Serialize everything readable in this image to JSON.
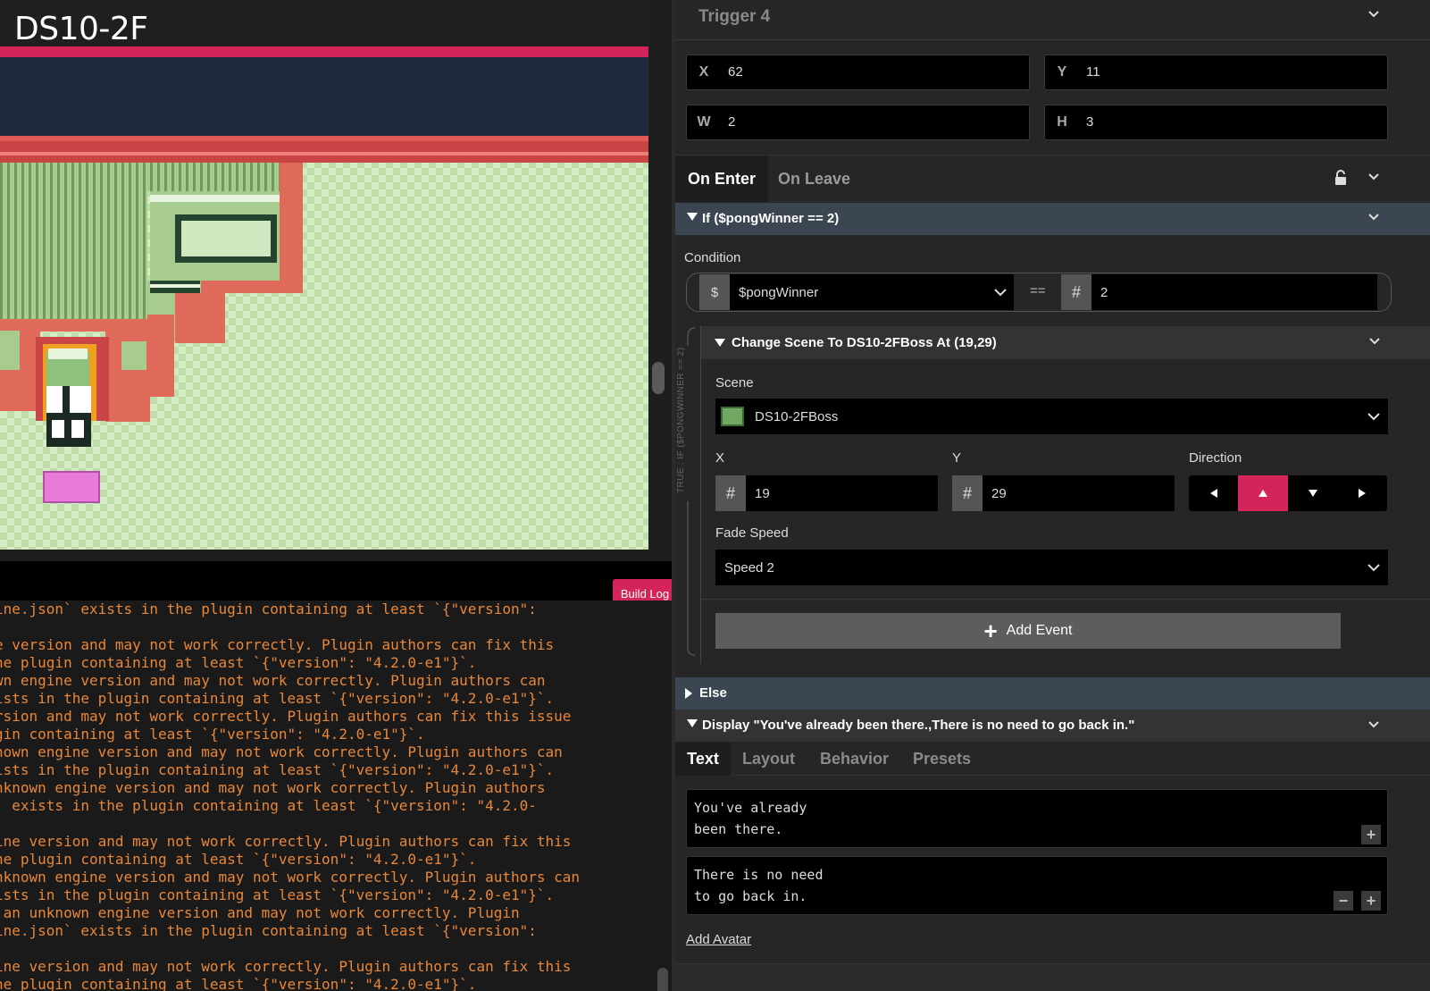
{
  "scene": {
    "title": "DS10-2F",
    "build_log_label": "Build Log"
  },
  "console": {
    "lines": [
      "ine.json` exists in the plugin containing at least `{\"version\":",
      "",
      "e version and may not work correctly. Plugin authors can fix this",
      "he plugin containing at least `{\"version\": \"4.2.0-e1\"}`.",
      "wn engine version and may not work correctly. Plugin authors can",
      "ists in the plugin containing at least `{\"version\": \"4.2.0-e1\"}`.",
      "rsion and may not work correctly. Plugin authors can fix this issue",
      "gin containing at least `{\"version\": \"4.2.0-e1\"}`.",
      "nown engine version and may not work correctly. Plugin authors can",
      "ists in the plugin containing at least `{\"version\": \"4.2.0-e1\"}`.",
      "nknown engine version and may not work correctly. Plugin authors",
      "` exists in the plugin containing at least `{\"version\": \"4.2.0-",
      "",
      "ine version and may not work correctly. Plugin authors can fix this",
      "he plugin containing at least `{\"version\": \"4.2.0-e1\"}`.",
      "nknown engine version and may not work correctly. Plugin authors can",
      "ists in the plugin containing at least `{\"version\": \"4.2.0-e1\"}`.",
      " an unknown engine version and may not work correctly. Plugin",
      "ine.json` exists in the plugin containing at least `{\"version\":",
      "",
      "ine version and may not work correctly. Plugin authors can fix this",
      "he plugin containing at least `{\"version\": \"4.2.0-e1\"}`."
    ]
  },
  "trigger": {
    "title": "Trigger 4",
    "x_label": "X",
    "x_value": "62",
    "y_label": "Y",
    "y_value": "11",
    "w_label": "W",
    "w_value": "2",
    "h_label": "H",
    "h_value": "3"
  },
  "tabs": {
    "on_enter": "On Enter",
    "on_leave": "On Leave"
  },
  "if_block": {
    "header": "If ($pongWinner == 2)",
    "condition_label": "Condition",
    "var_prefix": "$",
    "variable": "$pongWinner",
    "operator": "==",
    "value_prefix": "#",
    "value": "2",
    "true_rail_label": "TRUE : IF ($PONGWINNER == 2)"
  },
  "change_scene": {
    "header": "Change Scene To DS10-2FBoss At (19,29)",
    "scene_label": "Scene",
    "scene_value": "DS10-2FBoss",
    "x_label": "X",
    "x_prefix": "#",
    "x_value": "19",
    "y_label": "Y",
    "y_prefix": "#",
    "y_value": "29",
    "direction_label": "Direction",
    "direction_selected": "up",
    "fade_label": "Fade Speed",
    "fade_value": "Speed 2",
    "add_event_label": "Add Event"
  },
  "else_block": {
    "header": "Else"
  },
  "display": {
    "header": "Display \"You've already been there.,There is no need to go back in.\"",
    "tabs": [
      "Text",
      "Layout",
      "Behavior",
      "Presets"
    ],
    "text_1": "You've already\nbeen there.",
    "text_2": "There is no need\nto go back in.",
    "add_avatar": "Add Avatar"
  },
  "colors": {
    "accent": "#d4245a",
    "section_header": "#3b4652",
    "console_text": "#e8873a"
  }
}
